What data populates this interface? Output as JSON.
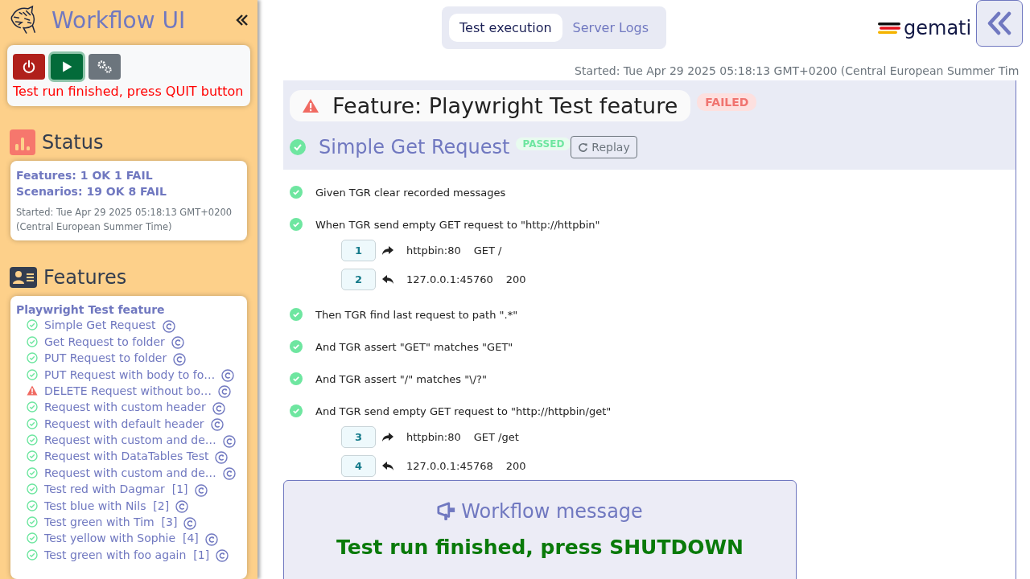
{
  "sidebar": {
    "title": "Workflow UI",
    "controls": [
      {
        "kind": "quit",
        "focused": false
      },
      {
        "kind": "play",
        "focused": true
      },
      {
        "kind": "settings",
        "focused": false
      }
    ],
    "run_message": "Test run finished, press QUIT button",
    "status": {
      "heading": "Status",
      "lines": [
        "Features: 1 OK 1 FAIL",
        "Scenarios: 19 OK 8 FAIL"
      ],
      "started": "Started: Tue Apr 29 2025 05:18:13 GMT+0200 (Central European Summer Time)"
    },
    "features": {
      "heading": "Features",
      "feature": "Playwright Test feature",
      "scenarios": [
        {
          "name": "Simple Get Request",
          "passed": true
        },
        {
          "name": "Get Request to folder",
          "passed": true
        },
        {
          "name": "PUT Request to folder",
          "passed": true
        },
        {
          "name": "PUT Request with body to fo…",
          "passed": true
        },
        {
          "name": "DELETE Request without bo…",
          "passed": false
        },
        {
          "name": "Request with custom header",
          "passed": true
        },
        {
          "name": "Request with default header",
          "passed": true
        },
        {
          "name": "Request with custom and de…",
          "passed": true
        },
        {
          "name": "Request with DataTables Test",
          "passed": true
        },
        {
          "name": "Request with custom and de…",
          "passed": true
        },
        {
          "name": "Test red with Dagmar  [1]",
          "passed": true
        },
        {
          "name": "Test blue with Nils  [2]",
          "passed": true
        },
        {
          "name": "Test green with Tim  [3]",
          "passed": true
        },
        {
          "name": "Test yellow with Sophie  [4]",
          "passed": true
        },
        {
          "name": "Test green with foo again  [1]",
          "passed": true
        }
      ]
    }
  },
  "tabs": [
    {
      "label": "Test execution",
      "selected": true
    },
    {
      "label": "Server Logs",
      "selected": false
    }
  ],
  "logo_text": "gemati",
  "started": "Started: Tue Apr 29 2025 05:18:13 GMT+0200 (Central European Summer Tim",
  "feature": {
    "title": "Feature: Playwright Test feature",
    "passed": false,
    "badge": "FAILED"
  },
  "scenario": {
    "title": "Simple Get Request",
    "passed": true,
    "badge": "PASSED",
    "replay": "Replay"
  },
  "steps": [
    {
      "text": "Given TGR clear recorded messages",
      "passed": true
    },
    {
      "text": "When TGR send empty GET request to \"http://httpbin\"",
      "passed": true,
      "messages": [
        {
          "number": "1",
          "kind": "request",
          "host": "httpbin:80",
          "info": "GET /"
        },
        {
          "number": "2",
          "kind": "response",
          "host": "127.0.0.1:45760",
          "info": "200"
        }
      ]
    },
    {
      "text": "Then TGR find last request to path \".*\"",
      "passed": true
    },
    {
      "text": "And TGR assert \"GET\" matches \"GET\"",
      "passed": true
    },
    {
      "text": "And TGR assert \"/\" matches \"\\/?\"",
      "passed": true
    },
    {
      "text": "And TGR send empty GET request to \"http://httpbin/get\"",
      "passed": true,
      "messages": [
        {
          "number": "3",
          "kind": "request",
          "host": "httpbin:80",
          "info": "GET /get"
        },
        {
          "number": "4",
          "kind": "response",
          "host": "127.0.0.1:45768",
          "info": "200"
        }
      ]
    }
  ],
  "workflow_message": {
    "title": "Workflow message",
    "message": "Test run finished, press SHUTDOWN"
  }
}
